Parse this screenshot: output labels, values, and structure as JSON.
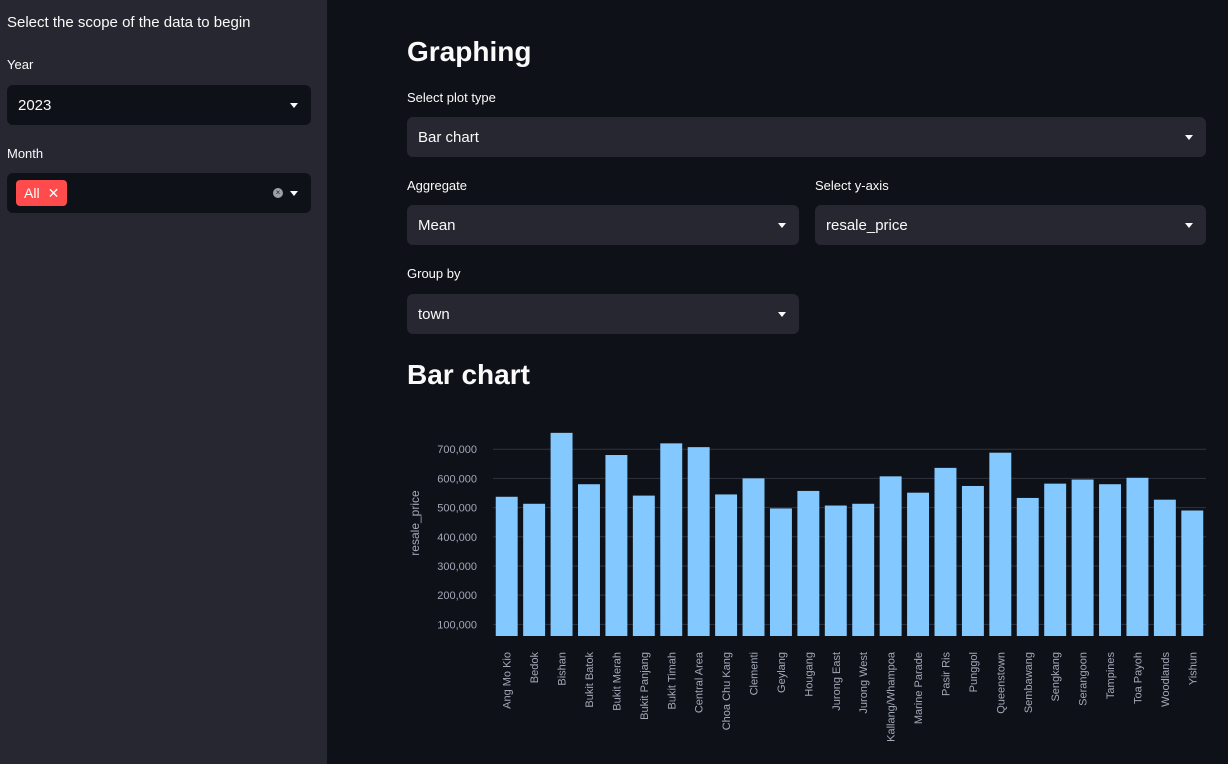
{
  "sidebar": {
    "heading": "Select the scope of the data to begin",
    "year": {
      "label": "Year",
      "value": "2023"
    },
    "month": {
      "label": "Month",
      "tag": "All",
      "tag_close": "✕"
    }
  },
  "main": {
    "title": "Graphing",
    "plot_type": {
      "label": "Select plot type",
      "value": "Bar chart"
    },
    "aggregate": {
      "label": "Aggregate",
      "value": "Mean"
    },
    "y_axis": {
      "label": "Select y-axis",
      "value": "resale_price"
    },
    "group_by": {
      "label": "Group by",
      "value": "town"
    },
    "chart_heading": "Bar chart"
  },
  "colors": {
    "bar": "#83c9ff",
    "accent": "#ff4b4b"
  },
  "chart_data": {
    "type": "bar",
    "categories": [
      "Ang Mo Kio",
      "Bedok",
      "Bishan",
      "Bukit Batok",
      "Bukit Merah",
      "Bukit Panjang",
      "Bukit Timah",
      "Central Area",
      "Choa Chu Kang",
      "Clementi",
      "Geylang",
      "Hougang",
      "Jurong East",
      "Jurong West",
      "Kallang/Whampoa",
      "Marine Parade",
      "Pasir Ris",
      "Punggol",
      "Queenstown",
      "Sembawang",
      "Sengkang",
      "Serangoon",
      "Tampines",
      "Toa Payoh",
      "Woodlands",
      "Yishun"
    ],
    "values": [
      537000,
      513000,
      756000,
      580000,
      680000,
      541000,
      720000,
      707000,
      545000,
      600000,
      497000,
      557000,
      507000,
      513000,
      607000,
      551000,
      636000,
      574000,
      688000,
      533000,
      582000,
      596000,
      580000,
      602000,
      527000,
      490000
    ],
    "ylabel": "resale_price",
    "yticks": [
      "100,000",
      "200,000",
      "300,000",
      "400,000",
      "500,000",
      "600,000",
      "700,000"
    ],
    "ytick_values": [
      100000,
      200000,
      300000,
      400000,
      500000,
      600000,
      700000
    ],
    "ylim": [
      60000,
      800000
    ]
  }
}
